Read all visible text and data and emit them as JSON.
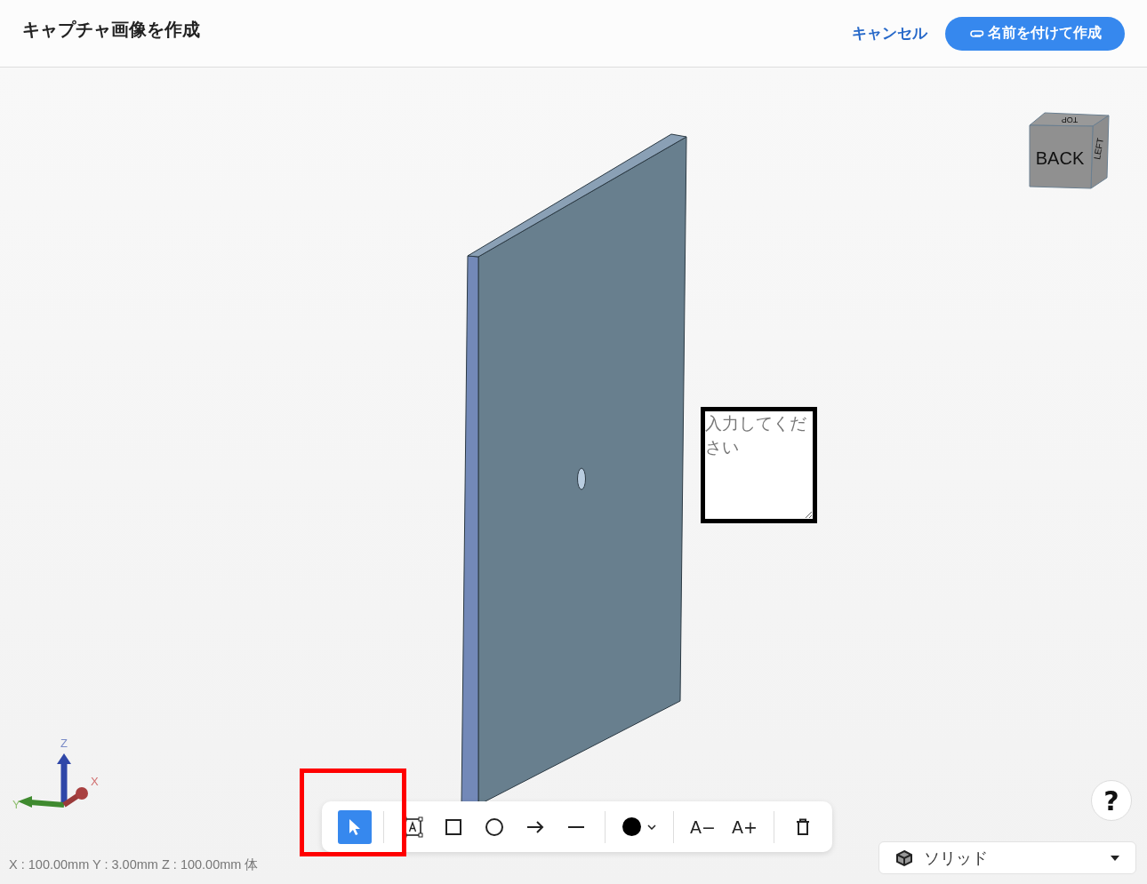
{
  "header": {
    "title": "キャプチャ画像を作成",
    "cancel": "キャンセル",
    "create": "名前を付けて作成"
  },
  "view_cube": {
    "top": "TOP",
    "front": "BACK",
    "side": "LEFT"
  },
  "axes": {
    "x": "X",
    "y": "Y",
    "z": "Z"
  },
  "note_field": {
    "placeholder": "入力してください"
  },
  "toolbar": {
    "tools": [
      {
        "kind": "pointer",
        "selected": true
      },
      {
        "kind": "textbox",
        "selected": false
      },
      {
        "kind": "rect",
        "selected": false
      },
      {
        "kind": "circle",
        "selected": false
      },
      {
        "kind": "arrow",
        "selected": false
      },
      {
        "kind": "line",
        "selected": false
      }
    ],
    "color": "#000000",
    "font_smaller": "A−",
    "font_larger": "A+"
  },
  "status": "X : 100.00mm Y : 3.00mm Z : 100.00mm 体",
  "help": "?",
  "display_mode": {
    "value": "ソリッド"
  }
}
